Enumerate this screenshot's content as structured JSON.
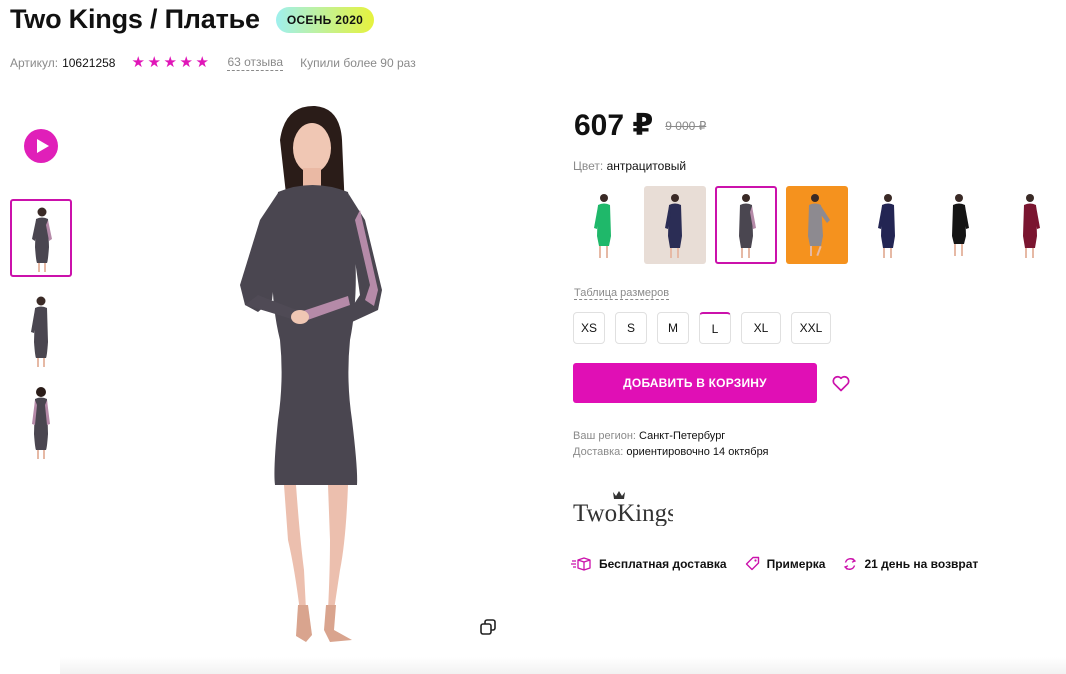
{
  "product": {
    "title": "Two Kings / Платье",
    "season_badge": "ОСЕНЬ 2020",
    "sku_label": "Артикул:",
    "sku_value": "10621258",
    "rating": 5,
    "reviews_link": "63 отзыва",
    "bought_text": "Купили более 90 раз"
  },
  "pricing": {
    "price": "607 ₽",
    "old_price": "9 000 ₽"
  },
  "color": {
    "label": "Цвет:",
    "value": "антрацитовый",
    "swatches": [
      {
        "name": "green",
        "color": "#1fb86a"
      },
      {
        "name": "navy-beige",
        "color": "#2b2d55"
      },
      {
        "name": "anthracite",
        "color": "#4a4650"
      },
      {
        "name": "grey-orange",
        "color": "#8d8a90"
      },
      {
        "name": "navy",
        "color": "#232553"
      },
      {
        "name": "black",
        "color": "#151515"
      },
      {
        "name": "burgundy",
        "color": "#7a1530"
      }
    ],
    "selected_index": 2
  },
  "sizes": {
    "table_link": "Таблица размеров",
    "options": [
      "XS",
      "S",
      "M",
      "L",
      "XL",
      "XXL"
    ],
    "selected": "L"
  },
  "actions": {
    "add_to_cart": "ДОБАВИТЬ В КОРЗИНУ"
  },
  "delivery": {
    "region_label": "Ваш регион:",
    "region_value": "Санкт-Петербург",
    "delivery_label": "Доставка:",
    "delivery_value": "ориентировочно 14 октября"
  },
  "brand": {
    "logo_text": "TwoKings"
  },
  "benefits": {
    "free_delivery": "Бесплатная доставка",
    "fitting": "Примерка",
    "return": "21 день на возврат"
  },
  "icons": [
    "play-icon",
    "star-icon",
    "heart-icon",
    "zoom-icon",
    "truck-icon",
    "tag-icon",
    "return-icon"
  ],
  "colors": {
    "accent": "#cb11ab",
    "button": "#e00fb5",
    "dress": "#4a4650",
    "sleeve_stripe": "#b58aa8"
  }
}
